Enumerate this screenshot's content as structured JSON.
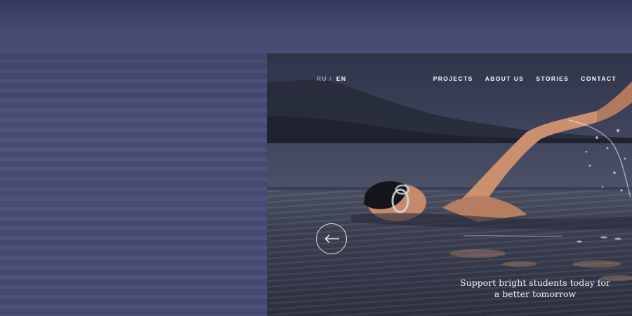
{
  "language_switch": {
    "inactive": "RU",
    "separator": "/",
    "active": "EN"
  },
  "nav": {
    "items": [
      {
        "label": "PROJECTS"
      },
      {
        "label": "ABOUT US"
      },
      {
        "label": "STORIES"
      },
      {
        "label": "CONTACT"
      }
    ]
  },
  "hero": {
    "tagline_line1": "Support bright students today for",
    "tagline_line2": "a better tomorrow",
    "prev_icon": "arrow-left-icon"
  },
  "colors": {
    "background": "#45496f",
    "text": "#ffffff",
    "muted": "#9aa0b6"
  }
}
